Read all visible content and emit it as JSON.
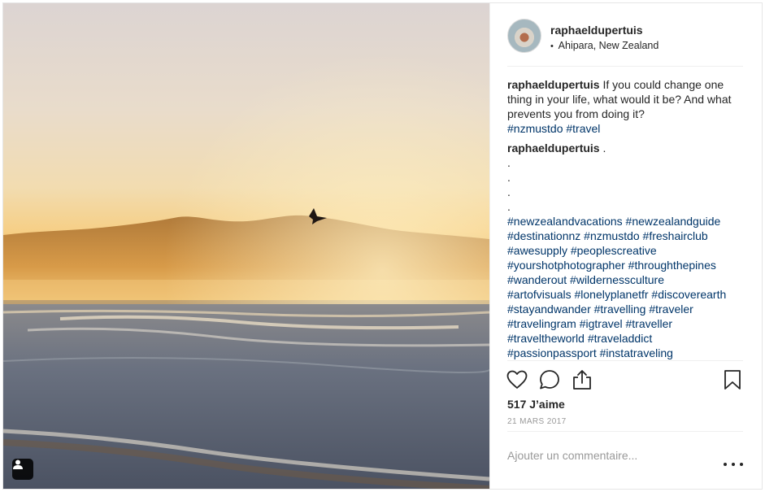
{
  "post": {
    "username": "raphaeldupertuis",
    "location": "Ahipara, New Zealand",
    "location_bullet": "•",
    "caption": {
      "username": "raphaeldupertuis",
      "text": "If you could change one thing in your life, what would it be? And what prevents you from doing it?",
      "tags": "#nzmustdo #travel"
    },
    "second_comment": {
      "username": "raphaeldupertuis",
      "first": ".",
      "dots": [
        ".",
        ".",
        ".",
        "."
      ],
      "tag_lines": [
        "#newzealandvacations #newzealandguide",
        "#destinationnz #nzmustdo #freshairclub",
        "#awesupply #peoplescreative",
        "#yourshotphotographer #throughthepines",
        "#wanderout #wildernessculture",
        "#artofvisuals #lonelyplanetfr #discoverearth",
        "#stayandwander #travelling #traveler",
        "#travelingram #igtravel #traveller",
        "#traveltheworld #traveladdict",
        "#passionpassport #instatraveling"
      ]
    },
    "likes": "517 J’aime",
    "date": "21 MARS 2017",
    "comment_placeholder": "Ajouter un commentaire...",
    "icons": [
      "heart-icon",
      "comment-icon",
      "share-icon",
      "bookmark-icon",
      "more-options-icon",
      "user-tag-icon"
    ]
  },
  "colors": {
    "hashtag": "#003569",
    "text": "#262626",
    "muted": "#999999",
    "border": "#efefef"
  }
}
